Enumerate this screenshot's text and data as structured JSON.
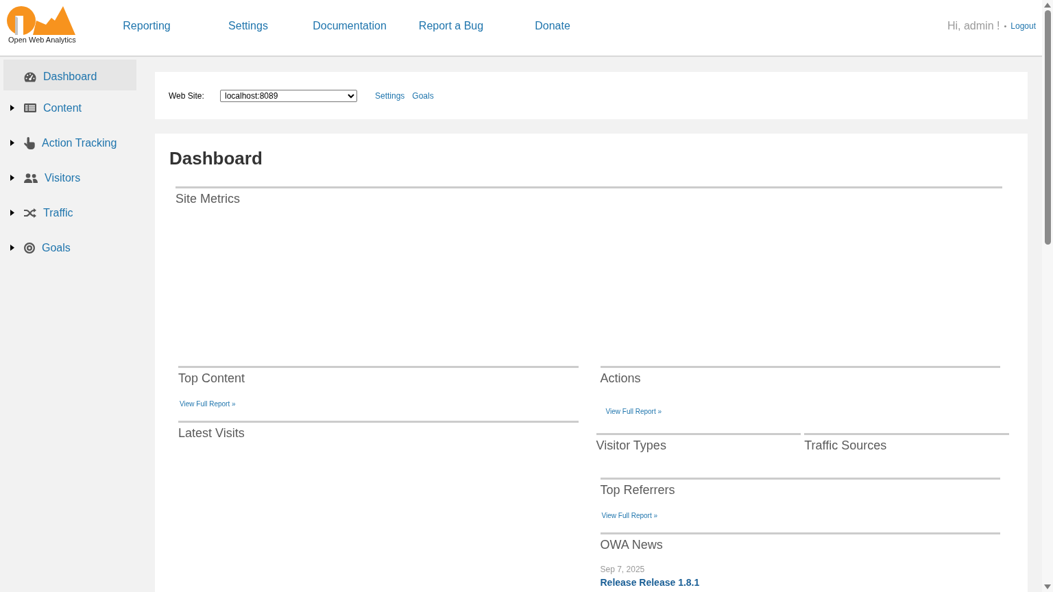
{
  "header": {
    "logo_text": "Open Web Analytics",
    "nav": [
      "Reporting",
      "Settings",
      "Documentation",
      "Report a Bug",
      "Donate"
    ],
    "greeting": "Hi, admin !",
    "separator": "•",
    "logout": "Logout"
  },
  "sidebar": {
    "items": [
      {
        "label": "Dashboard",
        "kind": "link",
        "selected": true
      },
      {
        "label": "Content",
        "kind": "menu",
        "selected": false,
        "expanded": false
      },
      {
        "label": "Action Tracking",
        "kind": "menu",
        "selected": false,
        "expanded": false
      },
      {
        "label": "Visitors",
        "kind": "menu",
        "selected": false,
        "expanded": false
      },
      {
        "label": "Traffic",
        "kind": "menu",
        "selected": false,
        "expanded": false
      },
      {
        "label": "Goals",
        "kind": "menu",
        "selected": false,
        "expanded": false
      }
    ]
  },
  "site_bar": {
    "label": "Web Site:",
    "site": "localhost:8089",
    "links": [
      "Settings",
      "Goals"
    ]
  },
  "dashboard": {
    "title": "Dashboard",
    "site_metrics": {
      "title": "Site Metrics"
    },
    "left_column": [
      {
        "kind": "widget",
        "title": "Top Content",
        "link": "View Full Report »"
      },
      {
        "kind": "widget",
        "title": "Latest Visits"
      }
    ],
    "right_column": [
      {
        "kind": "widget",
        "title": "Actions",
        "link": "View Full Report »"
      },
      {
        "kind": "pair",
        "widgets": [
          {
            "title": "Visitor Types"
          },
          {
            "title": "Traffic Sources"
          }
        ]
      },
      {
        "kind": "widget",
        "title": "Top Referrers",
        "link": "View Full Report »"
      },
      {
        "kind": "news",
        "title": "OWA News",
        "items": [
          {
            "date": "Sep 7, 2025",
            "headline": "Release Release 1.8.1"
          }
        ]
      }
    ]
  }
}
